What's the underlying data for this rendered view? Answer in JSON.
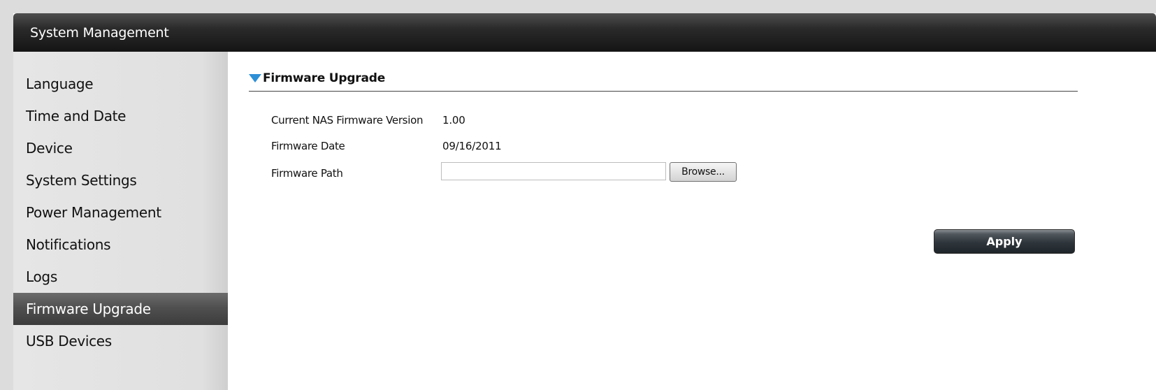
{
  "window": {
    "title": "System Management"
  },
  "sidebar": {
    "items": [
      {
        "label": "Language"
      },
      {
        "label": "Time and Date"
      },
      {
        "label": "Device"
      },
      {
        "label": "System Settings"
      },
      {
        "label": "Power Management"
      },
      {
        "label": "Notifications"
      },
      {
        "label": "Logs"
      },
      {
        "label": "Firmware Upgrade",
        "active": true
      },
      {
        "label": "USB Devices"
      }
    ]
  },
  "main": {
    "section_title": "Firmware Upgrade",
    "section_icon": "triangle-down-icon",
    "fields": {
      "current_version_label": "Current NAS Firmware Version",
      "current_version_value": "1.00",
      "firmware_date_label": "Firmware Date",
      "firmware_date_value": "09/16/2011",
      "firmware_path_label": "Firmware Path",
      "firmware_path_value": "",
      "browse_label": "Browse..."
    },
    "apply_label": "Apply"
  },
  "colors": {
    "accent_triangle": "#2d8fd6",
    "titlebar_dark": "#141414",
    "active_item": "#505050"
  }
}
